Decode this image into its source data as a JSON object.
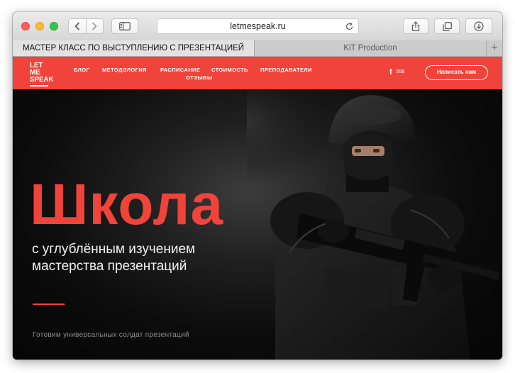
{
  "browser": {
    "url": "letmespeak.ru",
    "tabs": [
      {
        "label": "МАСТЕР КЛАСС ПО ВЫСТУПЛЕНИЮ С ПРЕЗЕНТАЦИЕЙ"
      },
      {
        "label": "KiT Production"
      }
    ],
    "new_tab_label": "+"
  },
  "site": {
    "logo_lines": [
      "LET ME",
      "SPEAK"
    ],
    "nav": [
      {
        "label": "БЛОГ"
      },
      {
        "label": "МЕТОДОЛОГИЯ"
      },
      {
        "label": "РАСПИСАНИЕ"
      },
      {
        "label": "СТОИМОСТЬ"
      },
      {
        "label": "ПРЕПОДАВАТЕЛИ"
      },
      {
        "label": "ОТЗЫВЫ"
      }
    ],
    "social_icon": "f",
    "social_count": "556",
    "cta_label": "Написать нам",
    "accent_color": "#f0433a"
  },
  "hero": {
    "title": "Школа",
    "subtitle_lines": [
      "с углублённым изучением",
      "мастерства презентаций"
    ],
    "tagline": "Готовим универсальных солдат презентаций"
  }
}
